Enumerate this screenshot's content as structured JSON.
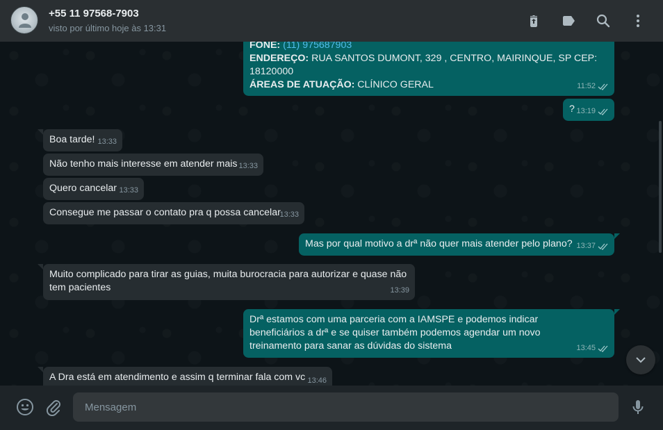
{
  "header": {
    "contact_name": "+55 11 97568-7903",
    "status": "visto por último hoje às 13:31",
    "icons": [
      "delete-icon",
      "label-icon",
      "search-icon",
      "menu-icon"
    ]
  },
  "messages": [
    {
      "direction": "out",
      "lines": [
        {
          "label": "FONE:",
          "value": "(11) 975687903"
        },
        {
          "label": "ENDEREÇO:",
          "value": "RUA SANTOS DUMONT, 329 , CENTRO, MAIRINQUE, SP CEP:"
        },
        {
          "label": "",
          "value": "18120000"
        },
        {
          "label": "ÁREAS DE ATUAÇÃO:",
          "value": "CLÍNICO GERAL"
        }
      ],
      "time": "11:52",
      "status": "read"
    },
    {
      "direction": "out",
      "text": "?",
      "time": "13:19",
      "status": "read"
    },
    {
      "direction": "in",
      "text": "Boa tarde!",
      "time": "13:33"
    },
    {
      "direction": "in",
      "text": "Não tenho mais interesse em atender mais",
      "time": "13:33"
    },
    {
      "direction": "in",
      "text": "Quero cancelar",
      "time": "13:33"
    },
    {
      "direction": "in",
      "text": "Consegue me passar o contato pra q possa cancelar",
      "time": "13:33"
    },
    {
      "direction": "out",
      "text": "Mas por qual motivo a drª não quer mais atender pelo plano?",
      "time": "13:37",
      "status": "read"
    },
    {
      "direction": "in",
      "text": "Muito complicado para tirar as guias, muita burocracia para autorizar e quase não tem pacientes",
      "time": "13:39"
    },
    {
      "direction": "out",
      "text": "Drª estamos com uma parceria com a IAMSPE e podemos indicar beneficiários a drª e se quiser também podemos agendar um novo treinamento para sanar as dúvidas do sistema",
      "time": "13:45",
      "status": "read"
    },
    {
      "direction": "in",
      "text": "A Dra está em atendimento e assim q terminar fala com vc",
      "time": "13:46"
    }
  ],
  "footer": {
    "placeholder": "Mensagem",
    "value": "",
    "icons": [
      "emoji-icon",
      "attach-icon",
      "microphone-icon"
    ]
  },
  "colors": {
    "background": "#0d1418",
    "header": "#2a2f32",
    "incoming_bubble": "#262d31",
    "outgoing_bubble": "#056162",
    "link": "#53bdeb"
  }
}
